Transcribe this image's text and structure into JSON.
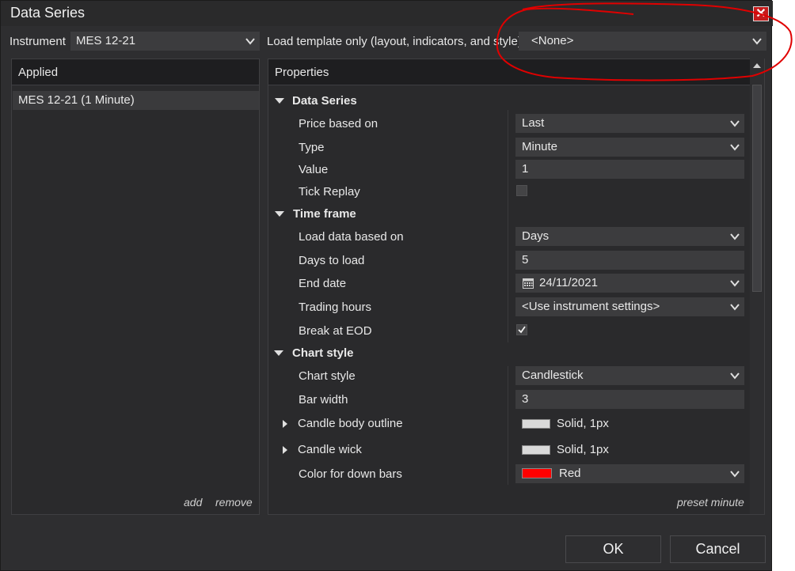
{
  "window": {
    "title": "Data Series"
  },
  "header": {
    "instrument_label": "Instrument",
    "instrument_value": "MES 12-21",
    "template_label": "Load template only (layout, indicators, and style)",
    "template_value": "<None>"
  },
  "applied": {
    "header": "Applied",
    "items": [
      "MES 12-21 (1 Minute)"
    ],
    "add_label": "add",
    "remove_label": "remove"
  },
  "properties": {
    "header": "Properties",
    "sections": {
      "data_series": "Data Series",
      "time_frame": "Time frame",
      "chart_style": "Chart style"
    },
    "rows": {
      "price_based_on": {
        "label": "Price based on",
        "value": "Last"
      },
      "type": {
        "label": "Type",
        "value": "Minute"
      },
      "value": {
        "label": "Value",
        "value": "1"
      },
      "tick_replay": {
        "label": "Tick Replay",
        "checked": false
      },
      "load_data_based_on": {
        "label": "Load data based on",
        "value": "Days"
      },
      "days_to_load": {
        "label": "Days to load",
        "value": "5"
      },
      "end_date": {
        "label": "End date",
        "value": "24/11/2021"
      },
      "trading_hours": {
        "label": "Trading hours",
        "value": "<Use instrument settings>"
      },
      "break_at_eod": {
        "label": "Break at EOD",
        "checked": true
      },
      "chart_style": {
        "label": "Chart style",
        "value": "Candlestick"
      },
      "bar_width": {
        "label": "Bar width",
        "value": "3"
      },
      "candle_body_outline": {
        "label": "Candle body outline",
        "value": "Solid, 1px",
        "color": "#d9d9d9"
      },
      "candle_wick": {
        "label": "Candle wick",
        "value": "Solid, 1px",
        "color": "#d9d9d9"
      },
      "color_for_down_bars": {
        "label": "Color for down bars",
        "value": "Red",
        "color": "#ff0000"
      }
    },
    "preset_label": "preset minute"
  },
  "buttons": {
    "ok": "OK",
    "cancel": "Cancel"
  },
  "colors": {
    "annotation": "#e00000",
    "close": "#c51b1b"
  }
}
